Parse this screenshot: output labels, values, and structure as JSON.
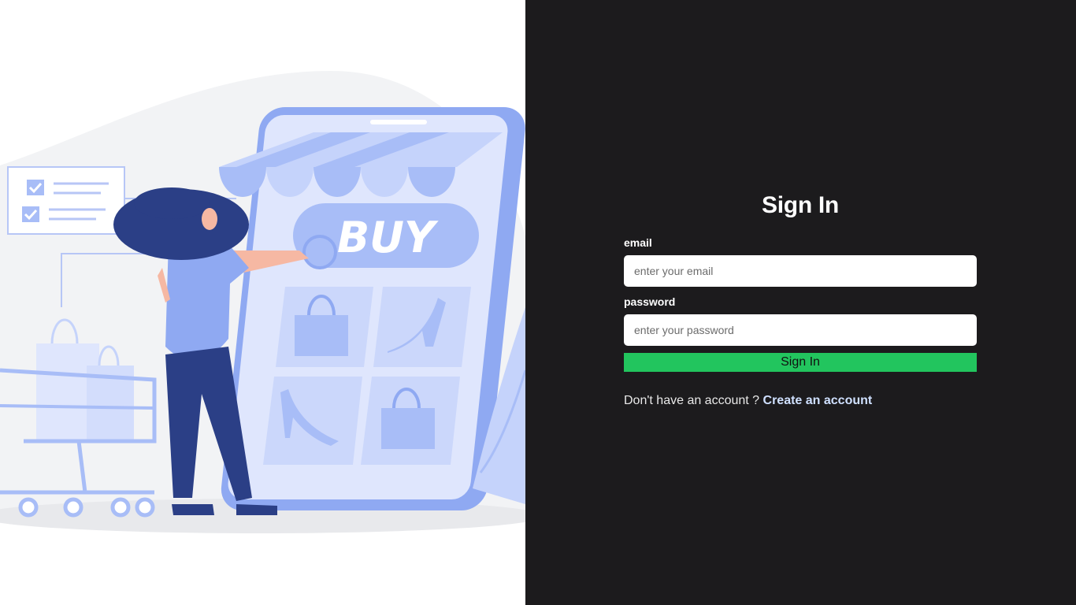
{
  "form": {
    "title": "Sign In",
    "email_label": "email",
    "email_placeholder": "enter your email",
    "email_value": "",
    "password_label": "password",
    "password_placeholder": "enter your password",
    "password_value": "",
    "submit_label": "Sign In",
    "signup_prompt": "Don't have an account ?",
    "signup_link": "Create an account"
  },
  "illustration": {
    "buy_text": "BUY"
  },
  "colors": {
    "panel_bg": "#1c1b1d",
    "accent_green": "#22c55e",
    "illustration_blue": "#a8bdf7",
    "figure_navy": "#2b3f86"
  }
}
